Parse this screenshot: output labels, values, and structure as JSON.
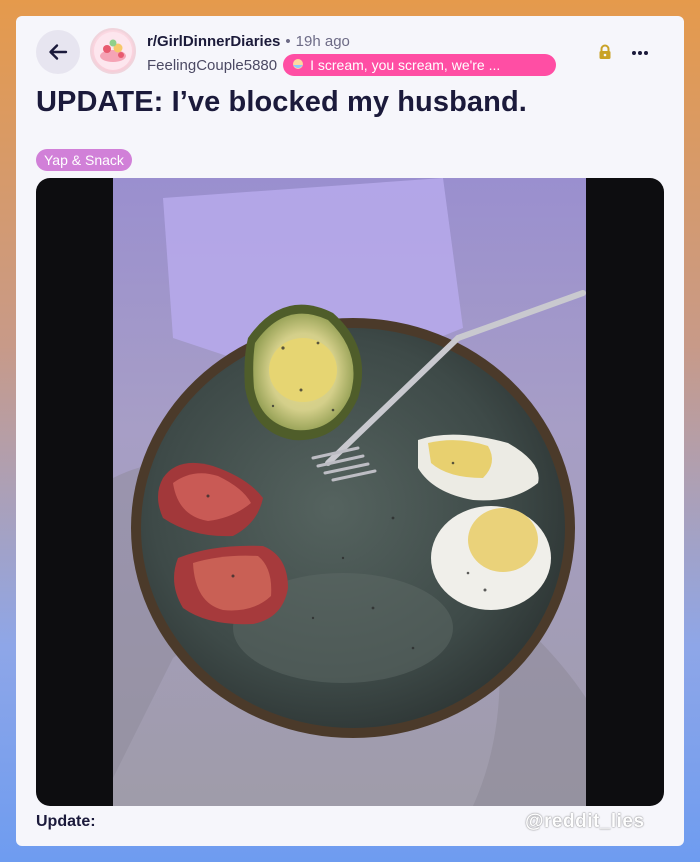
{
  "post": {
    "subreddit": "r/GirlDinnerDiaries",
    "separator": "•",
    "time": "19h ago",
    "username": "FeelingCouple5880",
    "user_flair": "I scream, you scream, we're ...",
    "title": "UPDATE: I’ve blocked my husband.",
    "post_flair": "Yap & Snack",
    "body_label": "Update:"
  },
  "watermark": "@reddit_lies",
  "colors": {
    "user_flair_bg": "#ff4ea4",
    "post_flair_bg": "#d180d8",
    "lock": "#c9a227",
    "title_text": "#1b1a3b"
  },
  "icons": [
    "back-arrow-icon",
    "lock-icon",
    "more-options-icon",
    "flair-emoji-icon"
  ]
}
